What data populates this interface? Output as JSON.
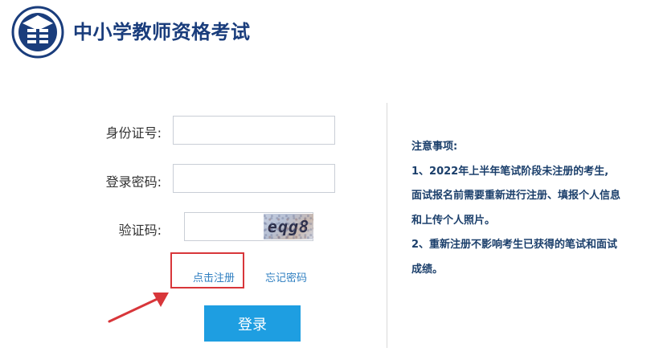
{
  "header": {
    "title": "中小学教师资格考试",
    "logo_icon": "book-emblem-icon"
  },
  "form": {
    "id_label": "身份证号:",
    "id_value": "",
    "password_label": "登录密码:",
    "password_value": "",
    "captcha_label": "验证码:",
    "captcha_value": "",
    "captcha_image_text": "eqg8"
  },
  "links": {
    "register": "点击注册",
    "forgot_password": "忘记密码"
  },
  "buttons": {
    "login": "登录"
  },
  "annotation": {
    "highlight_color": "#d8363a",
    "arrow_icon": "red-arrow-icon"
  },
  "notice": {
    "title": "注意事项:",
    "lines": [
      "1、2022年上半年笔试阶段未注册的考生,",
      "面试报名前需要重新进行注册、填报个人信息",
      "和上传个人照片。",
      "2、重新注册不影响考生已获得的笔试和面试",
      "成绩。"
    ]
  },
  "colors": {
    "brand": "#1a3d7c",
    "accent": "#1e9ee1",
    "link": "#2f7fc1",
    "notice_text": "#1b3f6b"
  }
}
